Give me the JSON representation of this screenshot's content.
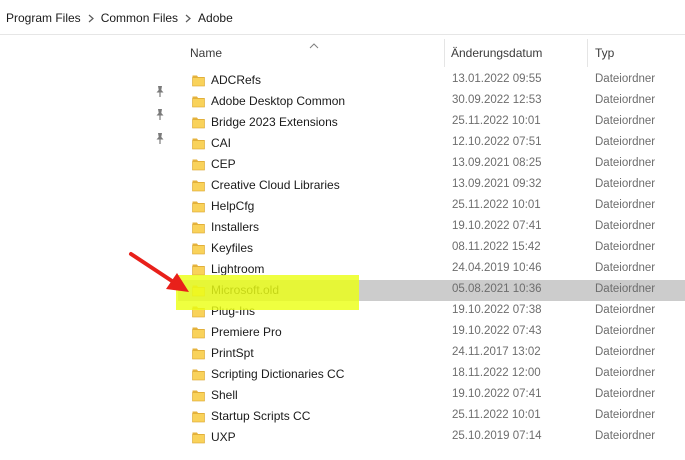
{
  "breadcrumb": [
    "Program Files",
    "Common Files",
    "Adobe"
  ],
  "columns": {
    "name": "Name",
    "date": "Änderungsdatum",
    "type": "Typ"
  },
  "sort": {
    "column": "name",
    "direction": "ascending"
  },
  "colors": {
    "selection": "#cccccc",
    "highlight": "#ecff16",
    "arrow": "#e8201a",
    "folder": "#f9d25a"
  },
  "files": [
    {
      "name": "ADCRefs",
      "date": "13.01.2022 09:55",
      "type": "Dateiordner"
    },
    {
      "name": "Adobe Desktop Common",
      "date": "30.09.2022 12:53",
      "type": "Dateiordner"
    },
    {
      "name": "Bridge 2023 Extensions",
      "date": "25.11.2022 10:01",
      "type": "Dateiordner"
    },
    {
      "name": "CAI",
      "date": "12.10.2022 07:51",
      "type": "Dateiordner"
    },
    {
      "name": "CEP",
      "date": "13.09.2021 08:25",
      "type": "Dateiordner"
    },
    {
      "name": "Creative Cloud Libraries",
      "date": "13.09.2021 09:32",
      "type": "Dateiordner"
    },
    {
      "name": "HelpCfg",
      "date": "25.11.2022 10:01",
      "type": "Dateiordner"
    },
    {
      "name": "Installers",
      "date": "19.10.2022 07:41",
      "type": "Dateiordner"
    },
    {
      "name": "Keyfiles",
      "date": "08.11.2022 15:42",
      "type": "Dateiordner"
    },
    {
      "name": "Lightroom",
      "date": "24.04.2019 10:46",
      "type": "Dateiordner"
    },
    {
      "name": "Microsoft.old",
      "date": "05.08.2021 10:36",
      "type": "Dateiordner",
      "selected": true,
      "highlighted": true
    },
    {
      "name": "Plug-Ins",
      "date": "19.10.2022 07:38",
      "type": "Dateiordner"
    },
    {
      "name": "Premiere Pro",
      "date": "19.10.2022 07:43",
      "type": "Dateiordner"
    },
    {
      "name": "PrintSpt",
      "date": "24.11.2017 13:02",
      "type": "Dateiordner"
    },
    {
      "name": "Scripting Dictionaries CC",
      "date": "18.11.2022 12:00",
      "type": "Dateiordner"
    },
    {
      "name": "Shell",
      "date": "19.10.2022 07:41",
      "type": "Dateiordner"
    },
    {
      "name": "Startup Scripts CC",
      "date": "25.11.2022 10:01",
      "type": "Dateiordner"
    },
    {
      "name": "UXP",
      "date": "25.10.2019 07:14",
      "type": "Dateiordner"
    }
  ],
  "icons": {
    "folder": "folder-icon",
    "pin": "pin-icon",
    "separator": "chevron-right-icon",
    "sort": "sort-up-icon",
    "annotation": "red-arrow-icon"
  }
}
